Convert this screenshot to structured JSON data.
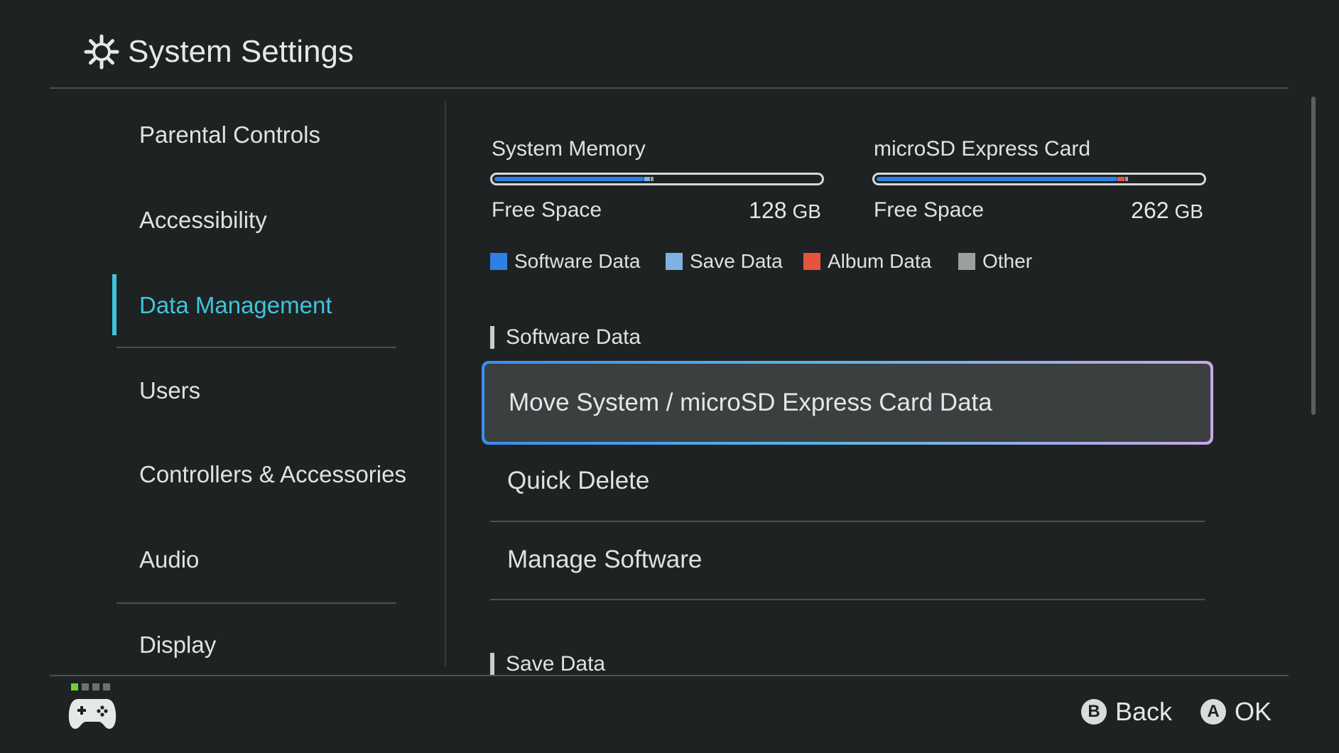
{
  "header": {
    "title": "System Settings",
    "icon": "gear-icon"
  },
  "sidebar": {
    "items": [
      {
        "label": "Parental Controls"
      },
      {
        "label": "Accessibility"
      },
      {
        "label": "Data Management"
      },
      {
        "label": "Users"
      },
      {
        "label": "Controllers & Accessories"
      },
      {
        "label": "Audio"
      },
      {
        "label": "Display"
      }
    ],
    "active_index": 2
  },
  "storage": {
    "system": {
      "label": "System Memory",
      "free_label": "Free Space",
      "free_value": "128",
      "free_unit": "GB",
      "used_fraction": 0.46
    },
    "microsd": {
      "label": "microSD Express Card",
      "free_label": "Free Space",
      "free_value": "262",
      "free_unit": "GB",
      "used_fraction": 0.74
    },
    "legend": [
      {
        "label": "Software Data",
        "color": "#2e7fe6"
      },
      {
        "label": "Save Data",
        "color": "#7fb2e2"
      },
      {
        "label": "Album Data",
        "color": "#e8533f"
      },
      {
        "label": "Other",
        "color": "#9aa0a0"
      }
    ]
  },
  "sections": {
    "software_data": {
      "title": "Software Data",
      "items": [
        {
          "label": "Move System / microSD Express Card Data"
        },
        {
          "label": "Quick Delete"
        },
        {
          "label": "Manage Software"
        }
      ]
    },
    "save_data": {
      "title": "Save Data"
    }
  },
  "footer": {
    "back": {
      "button": "B",
      "label": "Back"
    },
    "ok": {
      "button": "A",
      "label": "OK"
    }
  }
}
